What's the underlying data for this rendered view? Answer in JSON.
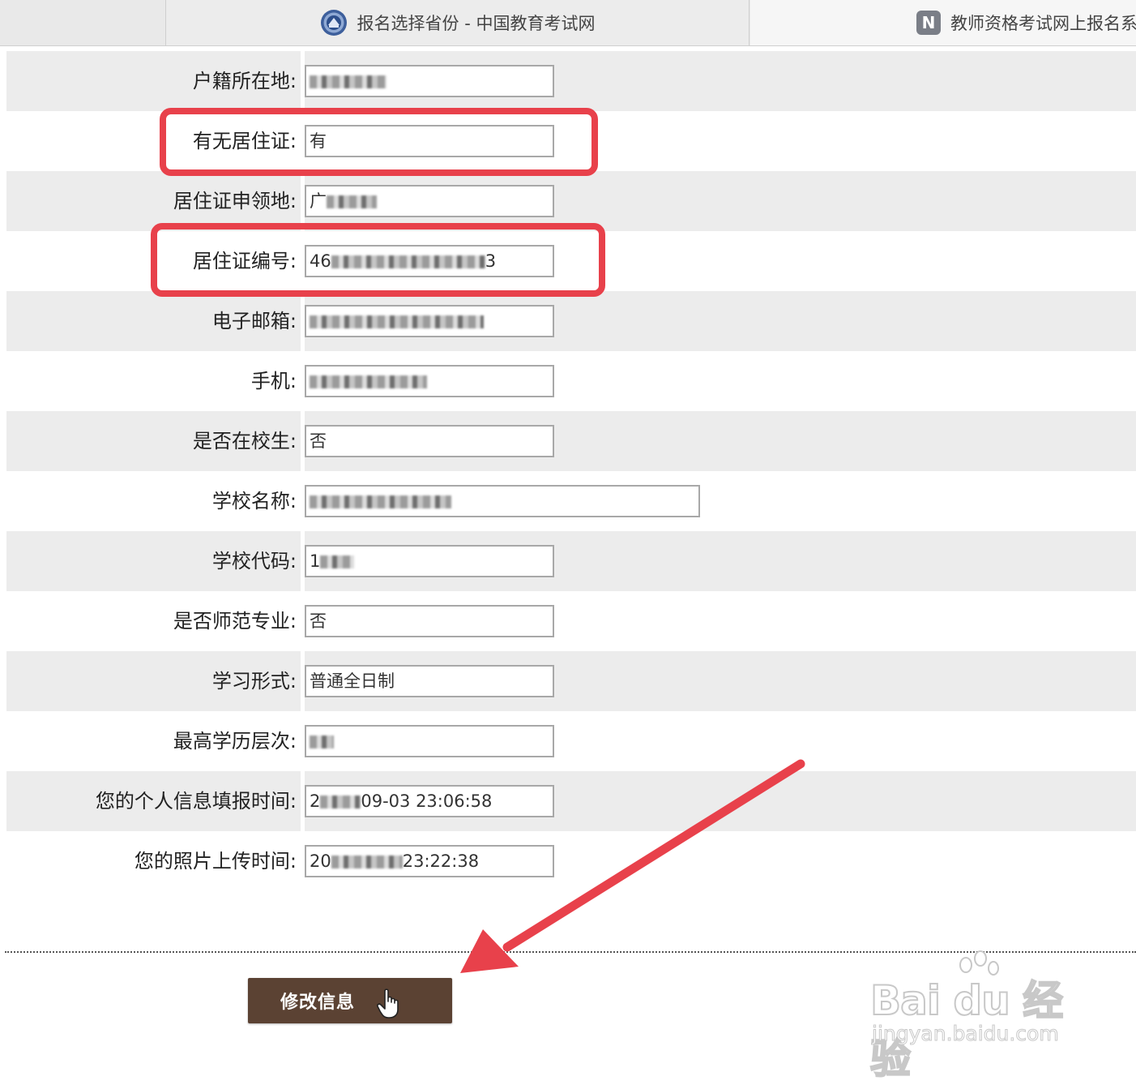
{
  "tabs": [
    {
      "title": "报名选择省份 - 中国教育考试网",
      "icon": "emblem-icon",
      "active": true
    },
    {
      "title": "教师资格考试网上报名系",
      "icon": "n-icon",
      "icon_letter": "N",
      "active": false
    }
  ],
  "form": {
    "rows": [
      {
        "label": "户籍所在地",
        "value": ""
      },
      {
        "label": "有无居住证",
        "value": "有"
      },
      {
        "label": "居住证申领地",
        "value": "广"
      },
      {
        "label": "居住证编号",
        "value": "46",
        "value_end": "3"
      },
      {
        "label": "电子邮箱",
        "value": ""
      },
      {
        "label": "手机",
        "value": ""
      },
      {
        "label": "是否在校生",
        "value": "否"
      },
      {
        "label": "学校名称",
        "value": ""
      },
      {
        "label": "学校代码",
        "value": "1"
      },
      {
        "label": "是否师范专业",
        "value": "否"
      },
      {
        "label": "学习形式",
        "value": "普通全日制"
      },
      {
        "label": "最高学历层次",
        "value": ""
      },
      {
        "label": "您的个人信息填报时间",
        "value": "2",
        "value_end": "09-03 23:06:58"
      },
      {
        "label": "您的照片上传时间",
        "value": "20",
        "value_end": "23:22:38"
      }
    ]
  },
  "actions": {
    "modify_label": "修改信息"
  },
  "watermark": {
    "main": "Bai du 经验",
    "sub": "jingyan.baidu.com"
  },
  "colors": {
    "highlight": "#e8414b",
    "button": "#5b4233",
    "row_shade": "#ececec"
  }
}
